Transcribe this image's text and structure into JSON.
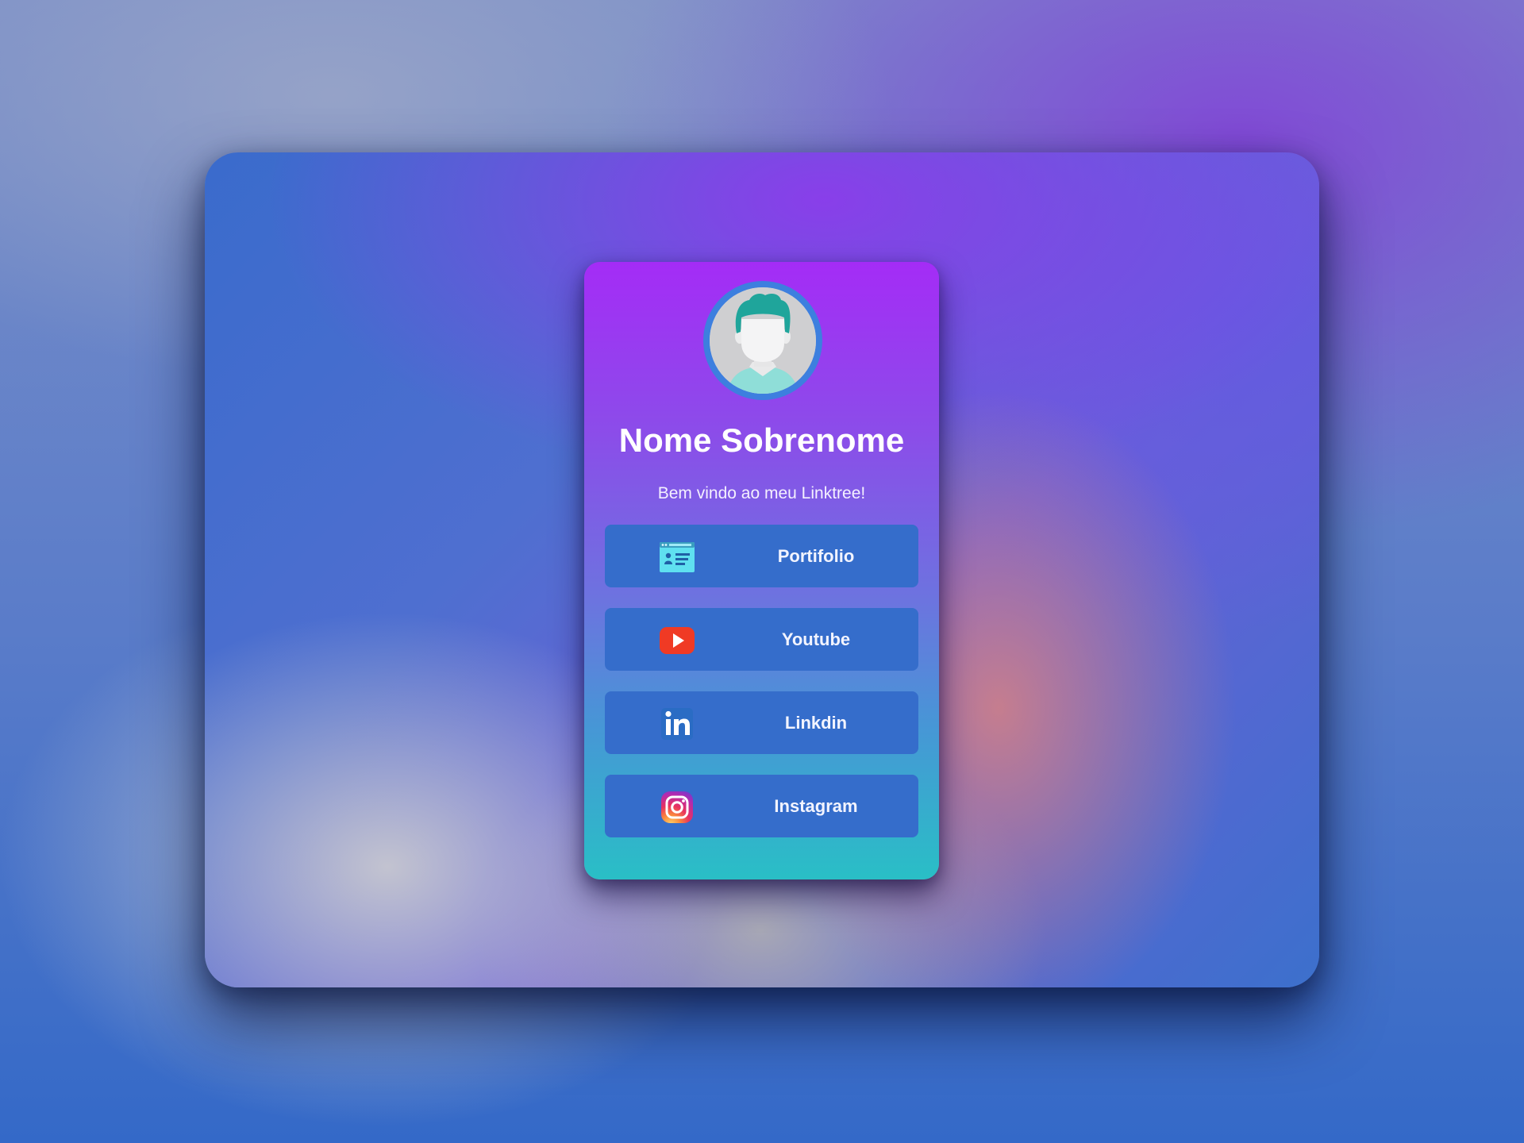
{
  "profile": {
    "name": "Nome Sobrenome",
    "welcome": "Bem vindo ao meu Linktree!"
  },
  "links": [
    {
      "label": "Portifolio",
      "icon": "portfolio-card-icon"
    },
    {
      "label": "Youtube",
      "icon": "youtube-icon"
    },
    {
      "label": "Linkdin",
      "icon": "linkedin-icon"
    },
    {
      "label": "Instagram",
      "icon": "instagram-icon"
    }
  ],
  "colors": {
    "card_top": "#a42cf6",
    "card_bottom": "#29bfc6",
    "button": "#356dcb",
    "avatar_ring": "#3d7fdf"
  }
}
